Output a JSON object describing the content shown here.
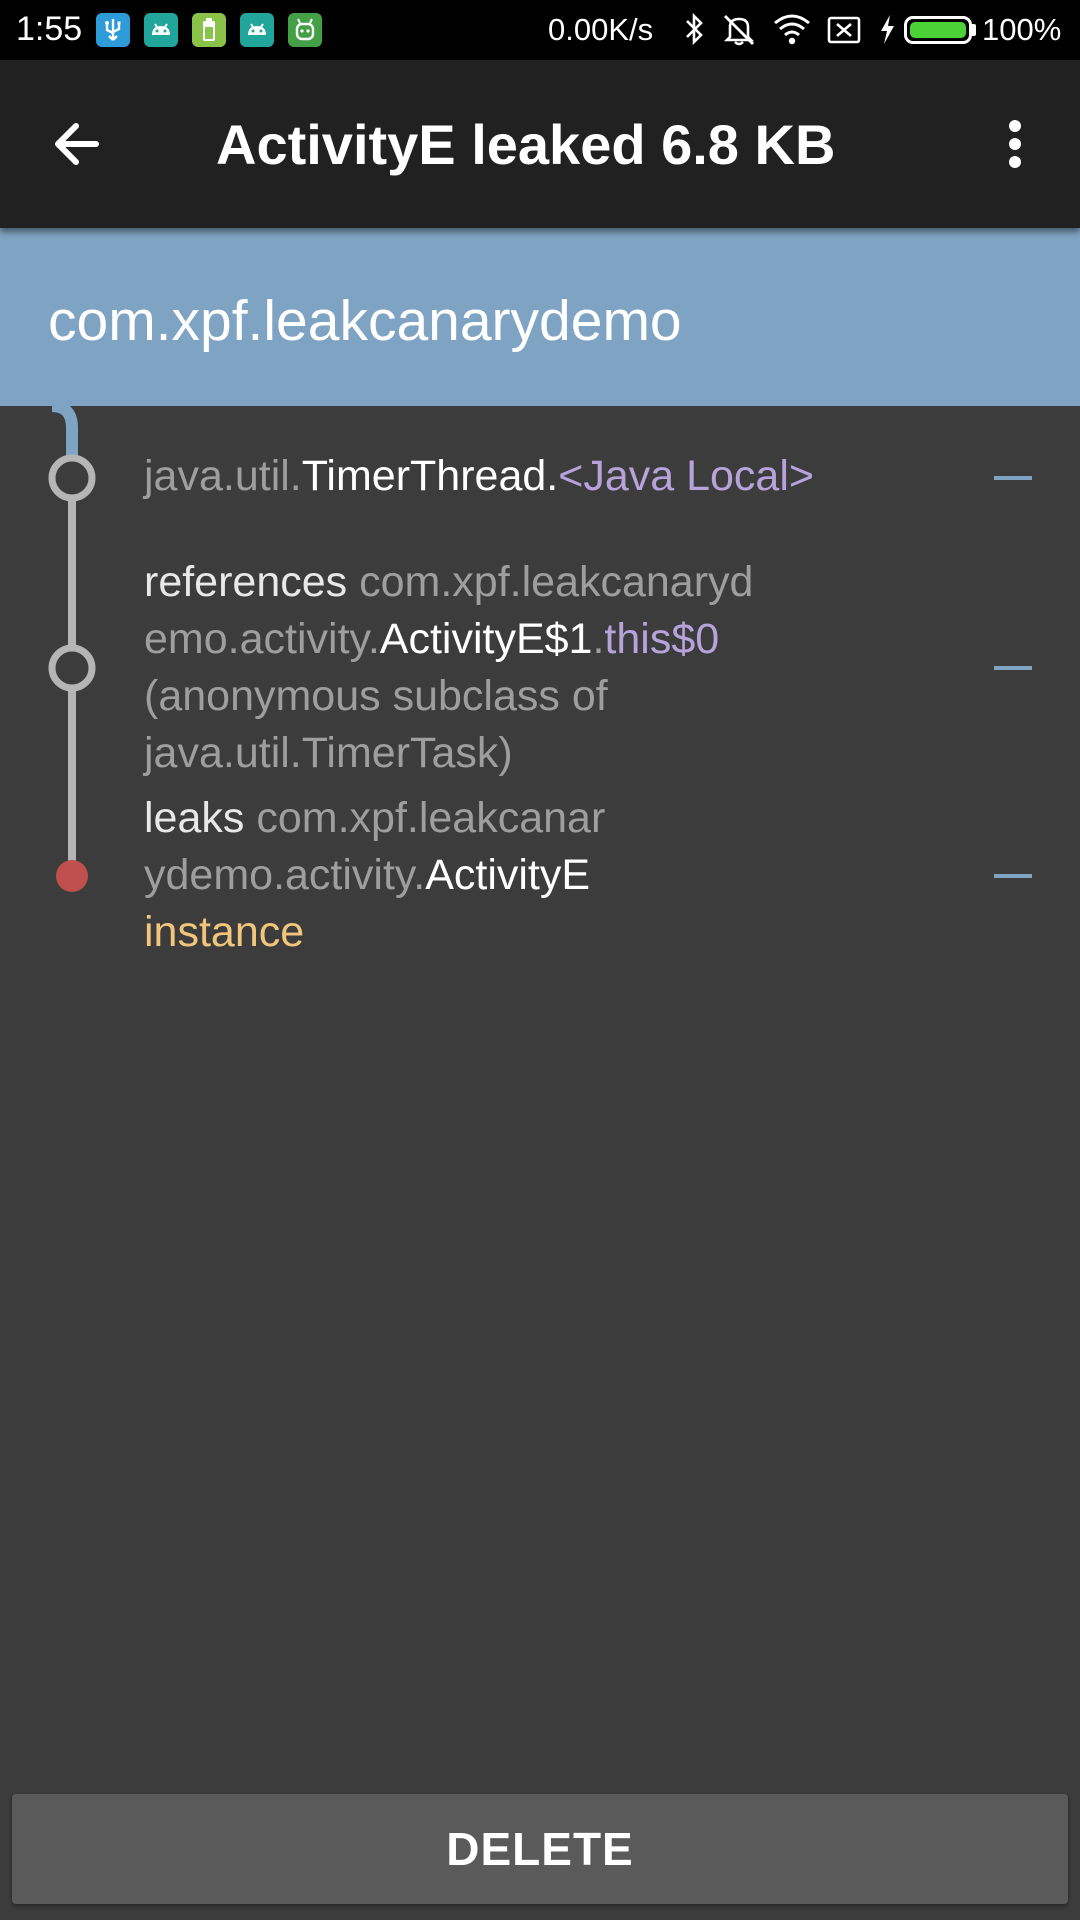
{
  "status_bar": {
    "time": "1:55",
    "network_speed": "0.00K/s",
    "battery_percent": "100%",
    "battery_level": 1.0,
    "app_icons": [
      "usb-debug-icon",
      "android-icon",
      "battery-app-icon",
      "android-icon",
      "android-robot-icon"
    ],
    "system_icons": [
      "bluetooth-icon",
      "mute-icon",
      "wifi-icon",
      "no-sim-icon",
      "charging-icon"
    ]
  },
  "toolbar": {
    "back_icon": "arrow-back-icon",
    "title": "ActivityE leaked 6.8 KB",
    "menu_icon": "more-vert-icon"
  },
  "header": {
    "package_name": "com.xpf.leakcanarydemo"
  },
  "trace": {
    "rows": [
      {
        "package": "java.util.",
        "class": "TimerThread.",
        "reference": "<Java Local>"
      },
      {
        "label": "references ",
        "package_line1": "com.xpf.leakcanaryd",
        "package_line2": "emo.activity.",
        "class": "ActivityE$1",
        "dot": ".",
        "reference": "this$0",
        "extra_line1": "(anonymous subclass of",
        "extra_line2": "java.util.TimerTask)"
      },
      {
        "label": "leaks ",
        "package_line1": "com.xpf.leakcanar",
        "package_line2": "ydemo.activity.",
        "class": "ActivityE",
        "instance": "instance"
      }
    ]
  },
  "actions": {
    "delete_label": "DELETE"
  },
  "colors": {
    "header_blue": "#7fa4c3",
    "toolbar": "#212121",
    "background": "#3c3c3c",
    "reference_purple": "#b7a3db",
    "instance_gold": "#f2c57c",
    "leak_red": "#c0504d"
  }
}
